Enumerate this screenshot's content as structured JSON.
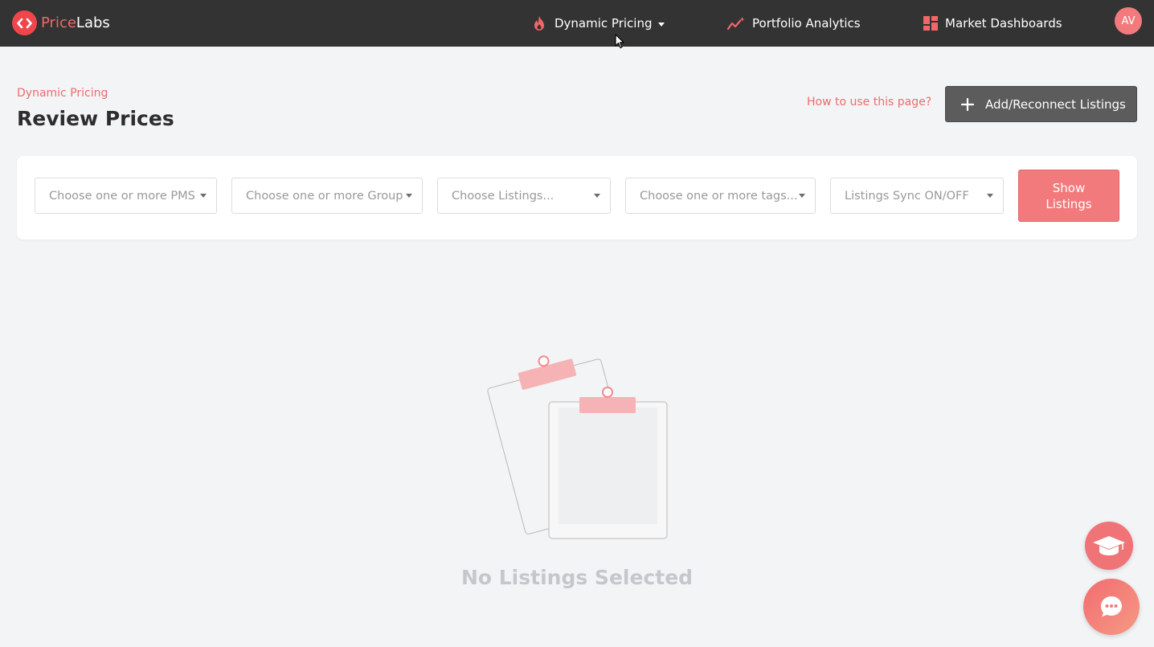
{
  "brand": {
    "name_part1": "Price",
    "name_part2": "Labs",
    "logo_icon": "code-brackets-icon"
  },
  "nav": {
    "dynamic_pricing": {
      "label": "Dynamic Pricing",
      "icon": "flame-icon"
    },
    "portfolio_analytics": {
      "label": "Portfolio Analytics",
      "icon": "trend-sparkle-icon"
    },
    "market_dashboards": {
      "label": "Market Dashboards",
      "icon": "dashboard-grid-icon"
    },
    "avatar_initials": "AV"
  },
  "header": {
    "breadcrumb": "Dynamic Pricing",
    "title": "Review Prices",
    "help_link": "How to use this page?",
    "add_button": "Add/Reconnect Listings"
  },
  "filters": {
    "pms_placeholder": "Choose one or more PMS",
    "group_placeholder": "Choose one or more Group",
    "listings_placeholder": "Choose Listings...",
    "tags_placeholder": "Choose one or more tags...",
    "sync_placeholder": "Listings Sync ON/OFF",
    "show_button_line1": "Show",
    "show_button_line2": "Listings"
  },
  "empty_state": {
    "message": "No Listings Selected",
    "icon": "clipboards-icon"
  },
  "floating": {
    "learn_icon": "graduation-cap-icon",
    "chat_icon": "chat-bubble-icon"
  },
  "colors": {
    "accent": "#f27a7d",
    "topbar": "#333333",
    "brand_red": "#f0464b"
  }
}
